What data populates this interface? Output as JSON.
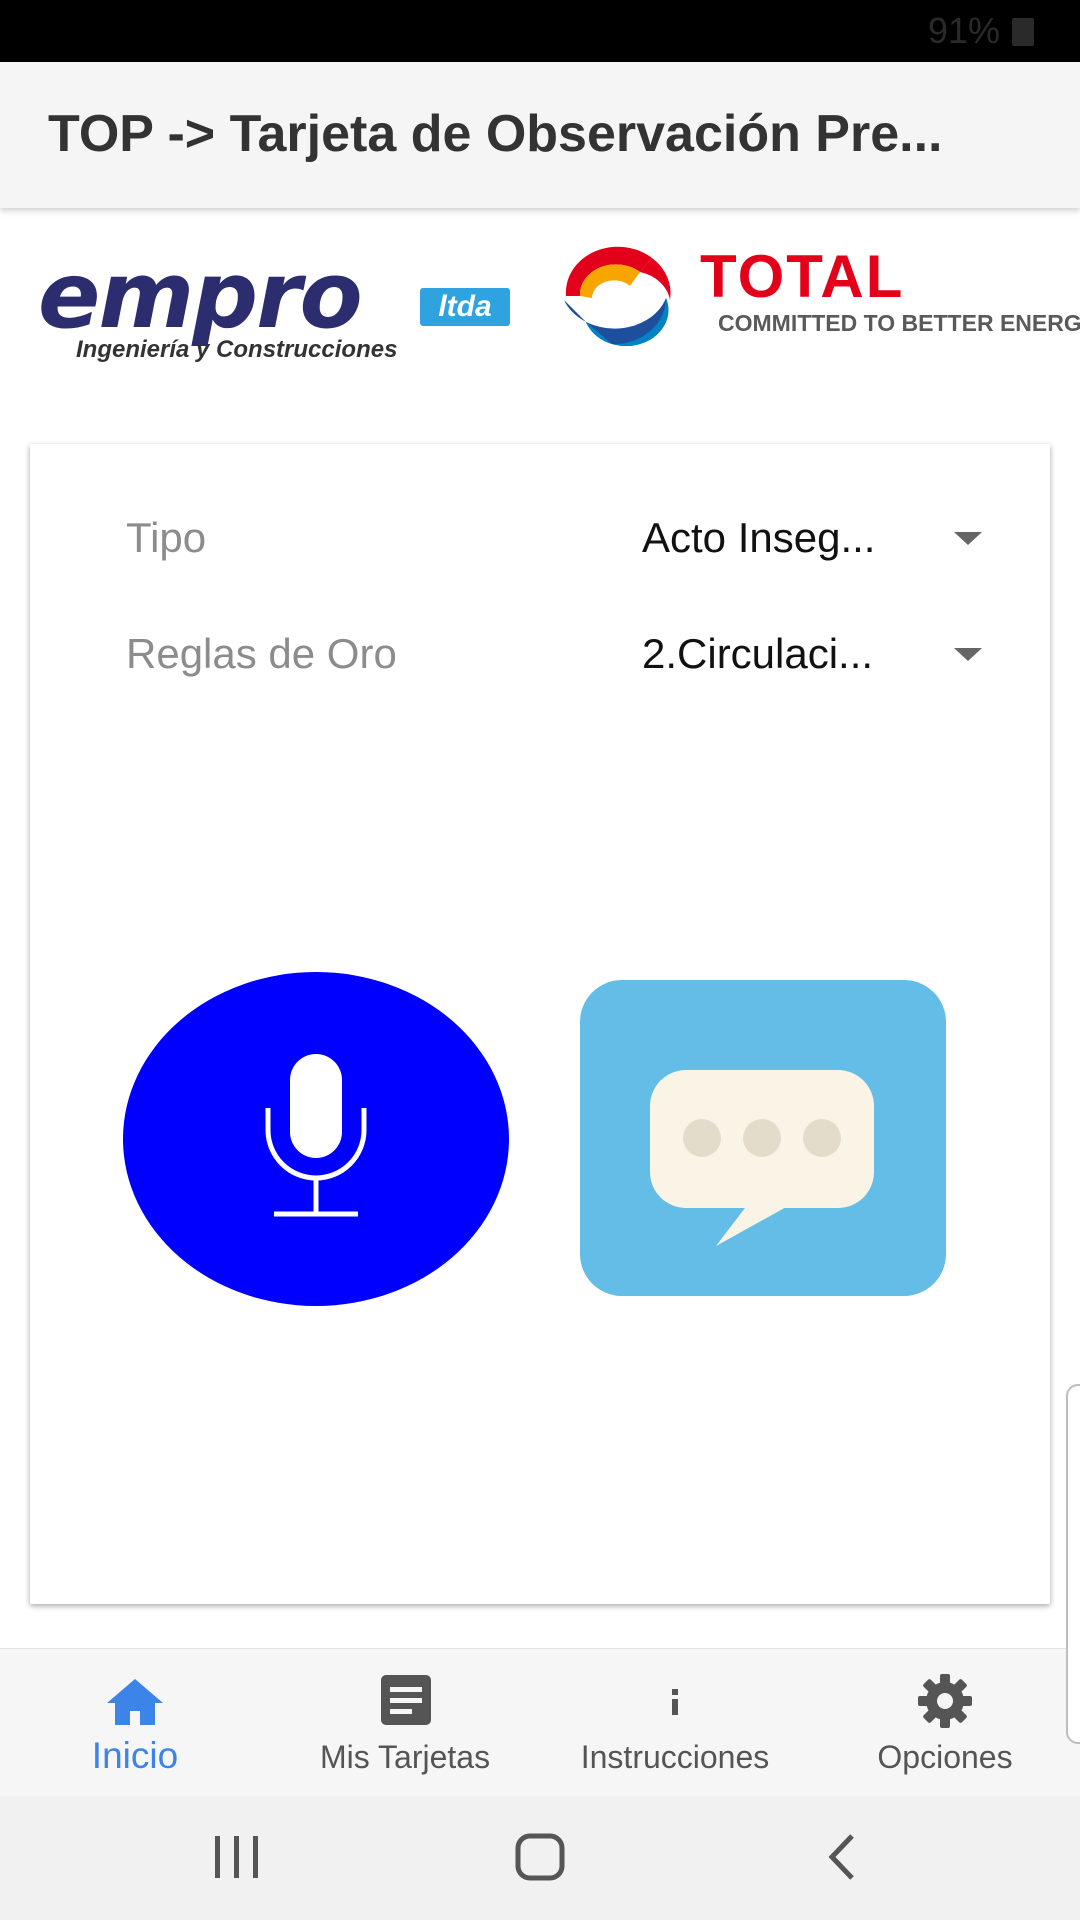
{
  "status_bar": {
    "battery_text": "91%",
    "battery_icon": "battery-icon"
  },
  "app_bar": {
    "title": "TOP -> Tarjeta de Observación Pre..."
  },
  "logos": {
    "empro": {
      "word": "empro",
      "badge": "ltda",
      "subtitle": "Ingeniería y Construcciones",
      "color": "#2b2d6e",
      "badge_color": "#2ea3e0"
    },
    "total": {
      "word": "TOTAL",
      "tagline": "COMMITTED TO BETTER ENERGY",
      "color": "#e2001a"
    }
  },
  "form": {
    "fields": [
      {
        "label": "Tipo",
        "value": "Acto Inseg..."
      },
      {
        "label": "Reglas de Oro",
        "value": "2.Circulaci..."
      }
    ]
  },
  "actions": {
    "mic": {
      "icon": "microphone-icon",
      "color": "#0000ff"
    },
    "chat": {
      "icon": "chat-bubble-icon",
      "color": "#64bde6"
    }
  },
  "bottom_nav": {
    "active_color": "#3d84e8",
    "items": [
      {
        "label": "Inicio",
        "icon": "home-icon",
        "active": true
      },
      {
        "label": "Mis Tarjetas",
        "icon": "cards-list-icon",
        "active": false
      },
      {
        "label": "Instrucciones",
        "icon": "info-icon",
        "active": false
      },
      {
        "label": "Opciones",
        "icon": "gear-icon",
        "active": false
      }
    ]
  },
  "system_nav": {
    "buttons": [
      "recent-apps-icon",
      "home-circle-icon",
      "back-icon"
    ]
  }
}
